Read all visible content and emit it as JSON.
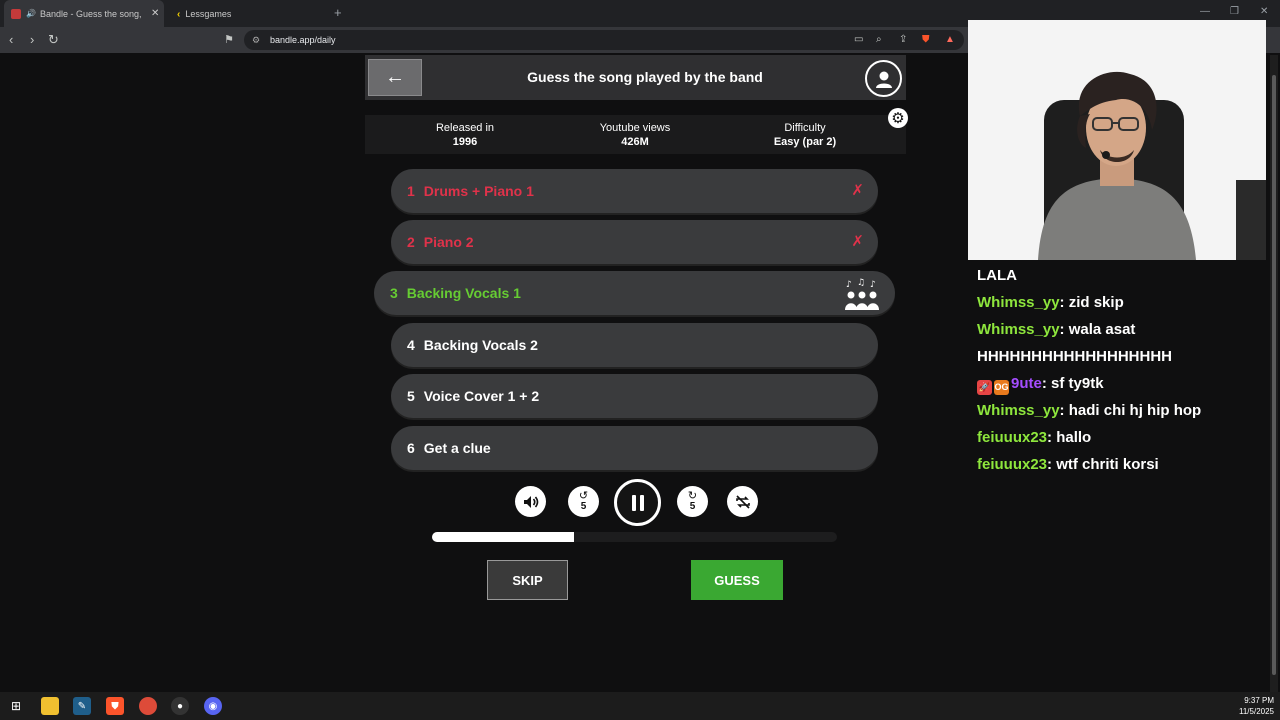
{
  "browser": {
    "tabs": [
      {
        "title": "Bandle - Guess the song, one instrument at a time",
        "active": true
      },
      {
        "title": "Lessgames",
        "active": false
      }
    ],
    "url": "bandle.app/daily"
  },
  "header": {
    "title": "Guess the song played by the band"
  },
  "stats": [
    {
      "label": "Released in",
      "value": "1996"
    },
    {
      "label": "Youtube views",
      "value": "426M"
    },
    {
      "label": "Difficulty",
      "value": "Easy (par 2)"
    }
  ],
  "clues": [
    {
      "num": "1",
      "label": "Drums + Piano 1",
      "state": "wrong",
      "mark": "✗"
    },
    {
      "num": "2",
      "label": "Piano 2",
      "state": "wrong",
      "mark": "✗"
    },
    {
      "num": "3",
      "label": "Backing Vocals 1",
      "state": "current"
    },
    {
      "num": "4",
      "label": "Backing Vocals 2",
      "state": "locked"
    },
    {
      "num": "5",
      "label": "Voice Cover 1 + 2",
      "state": "locked"
    },
    {
      "num": "6",
      "label": "Get a clue",
      "state": "locked"
    }
  ],
  "player": {
    "rewind_label": "5",
    "forward_label": "5",
    "progress": 0.35
  },
  "actions": {
    "skip_label": "SKIP",
    "guess_label": "GUESS"
  },
  "chat": {
    "title": "LALA",
    "messages": [
      {
        "user": "Whimss_yy",
        "text": "zid skip"
      },
      {
        "user": "Whimss_yy",
        "text": "wala asat"
      },
      {
        "user": "",
        "text": "HHHHHHHHHHHHHHHHHH"
      },
      {
        "user": "9ute",
        "text": "sf ty9tk"
      },
      {
        "user": "Whimss_yy",
        "text": "hadi chi hj hip hop"
      },
      {
        "user": "feiuuux23",
        "text": "hallo"
      },
      {
        "user": "feiuuux23",
        "text": "wtf chriti korsi"
      }
    ],
    "badge_text": "OG"
  },
  "taskbar": {
    "time": "9:37 PM",
    "date": "11/5/2025"
  },
  "colors": {
    "wrong": "#e0324a",
    "current": "#66cc33",
    "guess": "#3aa832",
    "chat_user": "#8ee63d",
    "chat_user_alt": "#a54dff"
  }
}
